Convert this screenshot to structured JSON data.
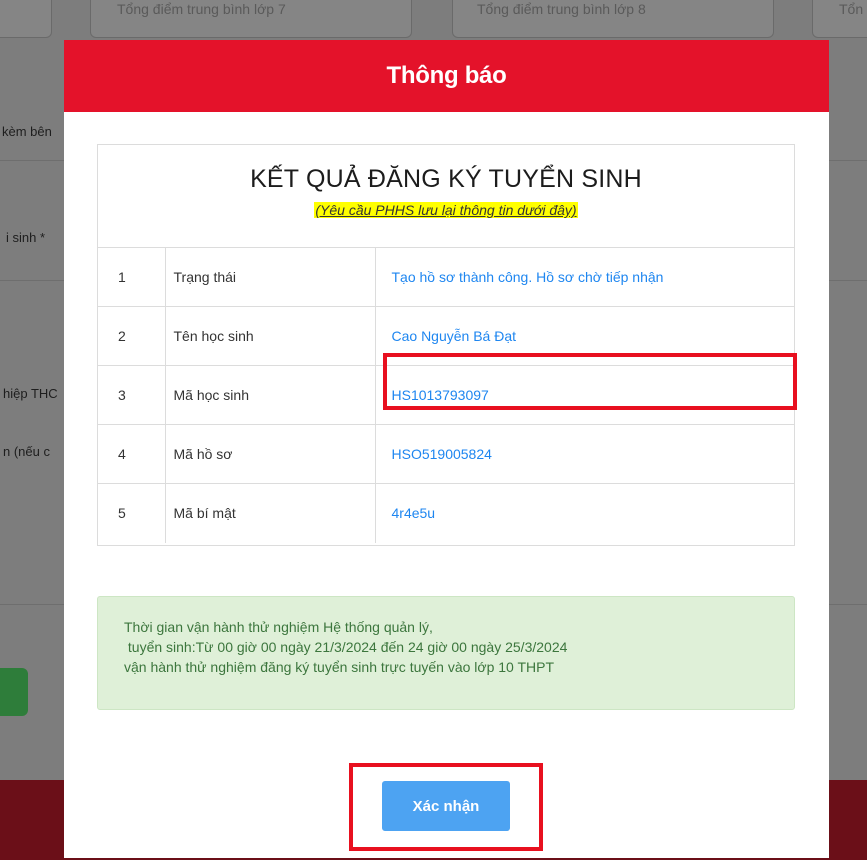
{
  "background": {
    "score_fields": [
      "Tổng điểm trung bình lớp 7",
      "Tổng điểm trung bình lớp 8",
      "Tổn"
    ],
    "side_labels": [
      "kèm bên",
      "i sinh *",
      "hiệp THC",
      "n (nếu c"
    ]
  },
  "modal": {
    "title": "Thông báo",
    "result": {
      "heading": "KẾT QUẢ ĐĂNG KÝ TUYỂN SINH",
      "note": "(Yêu cầu PHHS lưu lại thông tin dưới đây)",
      "rows": [
        {
          "index": "1",
          "label": "Trạng thái",
          "value": "Tạo hồ sơ thành công. Hồ sơ chờ tiếp nhận"
        },
        {
          "index": "2",
          "label": "Tên học sinh",
          "value": "Cao Nguyễn Bá Đạt"
        },
        {
          "index": "3",
          "label": "Mã học sinh",
          "value": "HS1013793097"
        },
        {
          "index": "4",
          "label": "Mã hồ sơ",
          "value": "HSO519005824"
        },
        {
          "index": "5",
          "label": "Mã bí mật",
          "value": "4r4e5u"
        }
      ]
    },
    "notice": {
      "lines": [
        "Thời gian vận hành thử nghiệm Hệ thống quản lý,",
        " tuyển sinh:Từ 00 giờ 00 ngày 21/3/2024 đến 24 giờ 00 ngày 25/3/2024",
        "vận hành thử nghiệm đăng ký tuyển sinh trực tuyến vào lớp 10 THPT"
      ]
    },
    "confirm_label": "Xác nhận"
  },
  "colors": {
    "header_red": "#e4122a",
    "link_blue": "#1e86f0",
    "highlight_red": "#e8101f",
    "notice_green_bg": "#dff0d8",
    "button_blue": "#4da3f2"
  }
}
